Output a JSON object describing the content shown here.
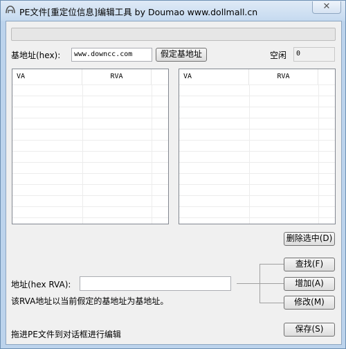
{
  "window": {
    "title": "PE文件[重定位信息]编辑工具 by Doumao www.dollmall.cn",
    "close_symbol": "✕"
  },
  "base": {
    "label": "基地址(hex):",
    "value": "www.downcc.com",
    "assume_button": "假定基地址"
  },
  "free": {
    "label": "空闲",
    "value": "0"
  },
  "left_list": {
    "columns": [
      "VA",
      "RVA"
    ]
  },
  "right_list": {
    "columns": [
      "VA",
      "RVA"
    ]
  },
  "delete_button": "删除选中(D)",
  "address": {
    "label": "地址(hex RVA):",
    "value": "",
    "hint": "该RVA地址以当前假定的基地址为基地址。"
  },
  "buttons": {
    "find": "查找(F)",
    "add": "增加(A)",
    "modify": "修改(M)",
    "save": "保存(S)"
  },
  "status": "拖进PE文件到对话框进行编辑"
}
